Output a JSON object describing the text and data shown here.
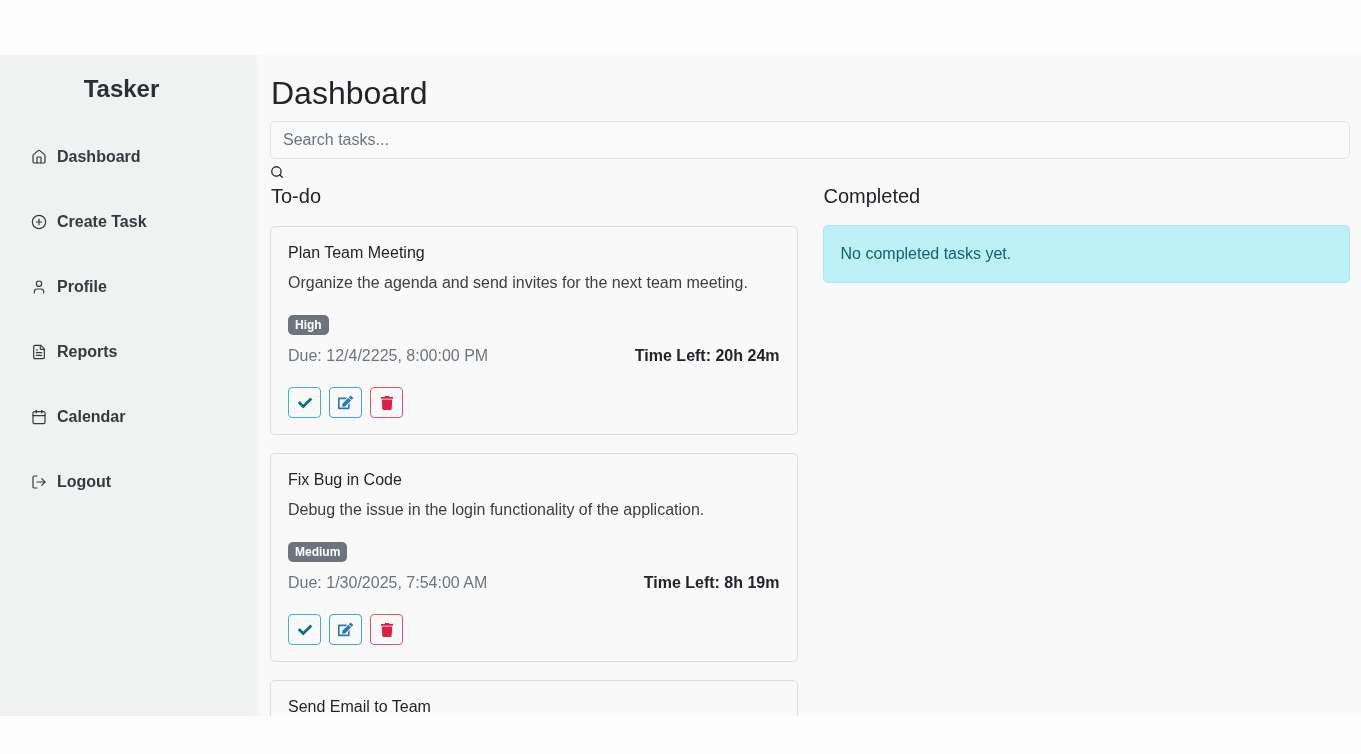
{
  "sidebar": {
    "brand": "Tasker",
    "items": [
      {
        "label": "Dashboard",
        "selected": false
      },
      {
        "label": "Create Task",
        "selected": false
      },
      {
        "label": "Profile",
        "selected": false
      },
      {
        "label": "Reports",
        "selected": false
      },
      {
        "label": "Calendar",
        "selected": false
      },
      {
        "label": "Logout",
        "selected": false
      }
    ]
  },
  "main": {
    "title": "Dashboard",
    "search": {
      "placeholder": "Search tasks..."
    },
    "todo": {
      "heading": "To-do",
      "tasks": [
        {
          "title": "Plan Team Meeting",
          "description": "Organize the agenda and send invites for the next team meeting.",
          "priority": "High",
          "due": "Due: 12/4/2225, 8:00:00 PM",
          "time_left": "Time Left: 20h 24m"
        },
        {
          "title": "Fix Bug in Code",
          "description": "Debug the issue in the login functionality of the application.",
          "priority": "Medium",
          "due": "Due: 1/30/2025, 7:54:00 AM",
          "time_left": "Time Left: 8h 19m"
        },
        {
          "title": "Send Email to Team"
        }
      ]
    },
    "completed": {
      "heading": "Completed",
      "empty_message": "No completed tasks yet."
    }
  }
}
